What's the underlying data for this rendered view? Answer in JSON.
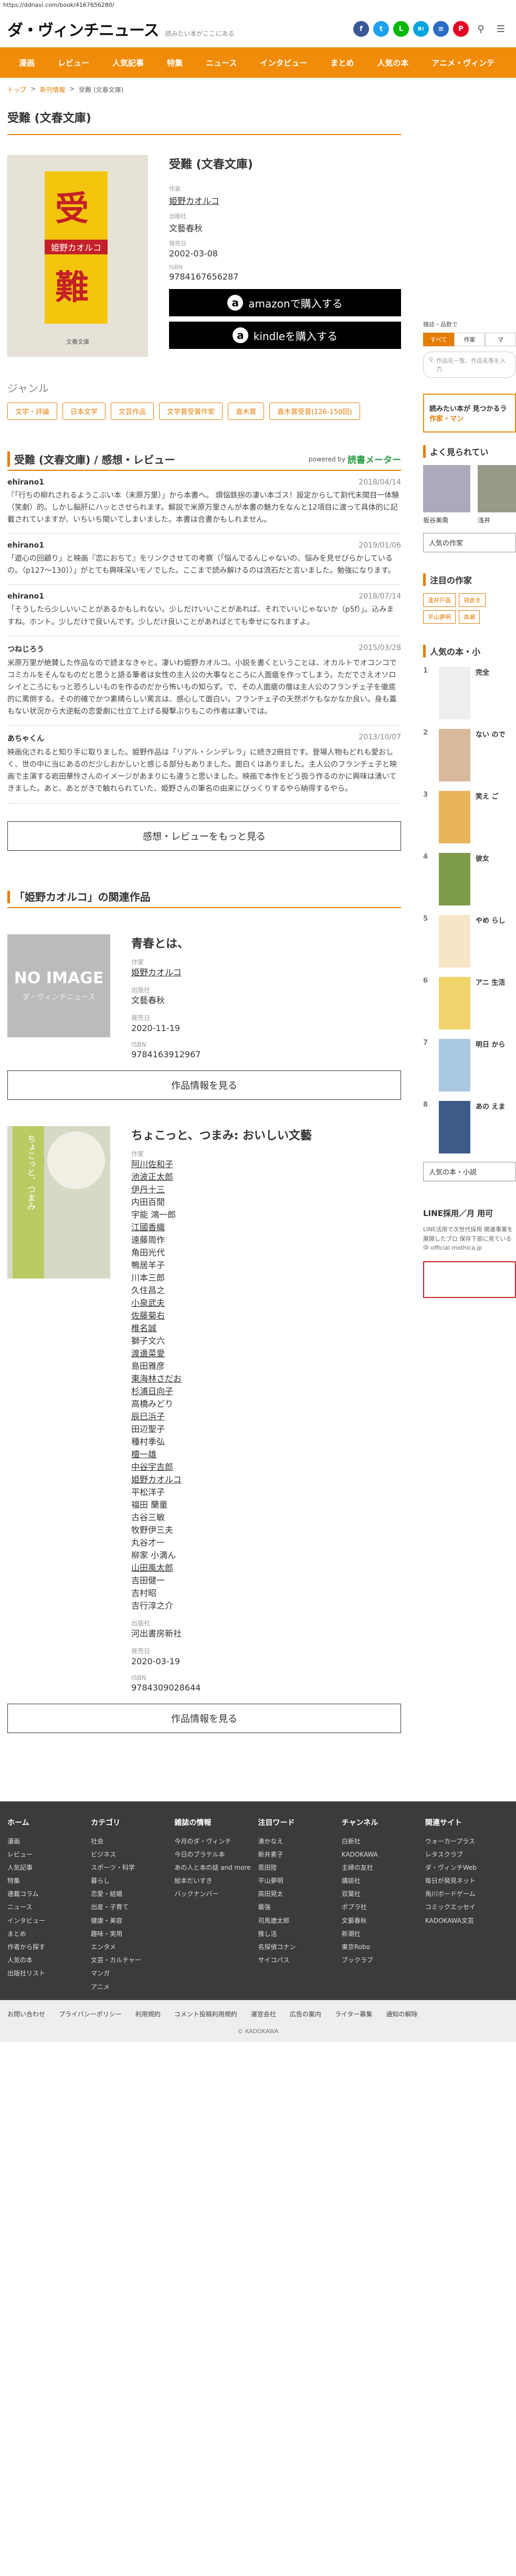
{
  "url": "https://ddnavi.com/book/4167656280/",
  "header": {
    "logo": "ダ・ヴィンチニュース",
    "tagline": "読みたい本がここにある"
  },
  "social": [
    {
      "name": "facebook-icon",
      "glyph": "f",
      "color": "#3b5998"
    },
    {
      "name": "twitter-icon",
      "glyph": "t",
      "color": "#1da1f2"
    },
    {
      "name": "line-icon",
      "glyph": "L",
      "color": "#00b900"
    },
    {
      "name": "hatena-icon",
      "glyph": "B!",
      "color": "#00a4de"
    },
    {
      "name": "feed-icon",
      "glyph": "≡",
      "color": "#2b6cc4"
    },
    {
      "name": "pinterest-icon",
      "glyph": "P",
      "color": "#e60023"
    }
  ],
  "nav": [
    "漫画",
    "レビュー",
    "人気記事",
    "特集",
    "ニュース",
    "インタビュー",
    "まとめ",
    "人気の本",
    "アニメ・ヴィンテ"
  ],
  "breadcrumb": {
    "home": "トップ",
    "sep": ">",
    "books": "新刊情報",
    "current": "受難 (文春文庫)"
  },
  "book": {
    "page_title": "受難 (文春文庫)",
    "title": "受難 (文春文庫)",
    "cover_kanji_1": "受",
    "cover_kanji_2": "難",
    "cover_author": "姫野カオルコ",
    "cover_foot": "文春文庫",
    "author_label": "作家",
    "author": "姫野カオルコ",
    "publisher_label": "出版社",
    "publisher": "文藝春秋",
    "date_label": "発売日",
    "date": "2002-03-08",
    "isbn_label": "ISBN",
    "isbn": "9784167656287",
    "amazon_btn": "amazonで購入する",
    "kindle_btn": "kindleを購入する"
  },
  "genre": {
    "heading": "ジャンル",
    "tags": [
      "文学・評論",
      "日本文学",
      "文芸作品",
      "文学賞受賞作家",
      "直木賞",
      "直木賞受賞(126-150回)"
    ]
  },
  "reviews": {
    "heading": "受難 (文春文庫) / 感想・レビュー",
    "powered": "powered by",
    "brand": "読書メーター",
    "items": [
      {
        "user": "ehirano1",
        "date": "2018/04/14",
        "text": "『「行ちの柳れされるようこぶい本（末原万里）」から本書へ。 煩悩鉄拐の凄い本ゴス！設定からして割代未聞目一体験（笑劇）的。しかし脳肝にハッとさせられます。解説で米原万里さんが本書の魅力をなんと12項目に渡って具体的に記載されていますが、いちいち聞いてしまいました。本書は合書かもしれません。"
      },
      {
        "user": "ehirano1",
        "date": "2019/01/06",
        "text": "「遊心の回顧り」と映画『恋におちて』をリンクさせての考察（「悩んでるんじゃないの、悩みを見せびらかしているの。（p127〜130））」がとても興味深いモノでした。ここまで読み解けるのは流石だと言いました。勉強になります。"
      },
      {
        "user": "ehirano1",
        "date": "2018/07/14",
        "text": "「そうしたら少しいいことがあるかもしれない。少しだけいいことがあれば、それでいいじゃないか（p5f）」。込みますね。ホント。少しだけで良いんです。少しだけ良いことがあればとても幸せになれますよ。"
      },
      {
        "user": "つねじろう",
        "date": "2015/03/28",
        "text": "米原万里が絶賛した作品なので読まなきゃと。凄いわ姫野カオルコ。小説を書くということは、オカルトでオコンコでコミカルをそんなものだと思うと語る筆者は女性の主人公の大事なところに人面瘡を作ってしまう。ただでさえオソロシイところにもっと恐ろしいものを作るのだから怖いもの知らず。で、その人面瘡の僧は主人公のフランチェ子を徹底的に罵倒する。その的確でかつ素晴らしい罵言は、感心して面白い。フランチェ子の天然ボケもなかなか良い。身も蓋もない状況から大逆転の恋愛劇に仕立て上げる擬撃ぶりもこの作者は凄いでは。"
      },
      {
        "user": "あちゃくん",
        "date": "2013/10/07",
        "text": "映画化されると知り手に取りました。姫野作品は「リアル・シンデレラ」に続き2冊目です。登場人物もどれも愛おしく、世の中に当にあるのだ少しおかしいと感じる部分もありました。面白くはありました。主人公のフランチェ子と映画で主演する岩田華怜さんのイメージがあまりにも違うと思いました。映画で本作をどう扱う作るのかに興味は湧いてきました。あと、あとがきで触れられていた、姫野さんの筆名の由来にびっくりするやら納得するやら。"
      }
    ],
    "more_btn": "感想・レビューをもっと見る"
  },
  "related": {
    "heading": "「姫野カオルコ」の関連作品",
    "items": [
      {
        "title": "青春とは、",
        "no_image": "NO IMAGE",
        "no_image_logo": "ダ・ヴィンチニュース",
        "author_label": "作家",
        "authors": [
          "姫野カオルコ"
        ],
        "publisher_label": "出版社",
        "publisher": "文藝春秋",
        "date_label": "発売日",
        "date": "2020-11-19",
        "isbn_label": "ISBN",
        "isbn": "9784163912967",
        "btn": "作品情報を見る"
      },
      {
        "title": "ちょこっと、つまみ: おいしい文藝",
        "cover_text": "ちょこっと、つまみ",
        "author_label": "作家",
        "authors": [
          "阿川佐和子",
          "池波正太郎",
          "伊丹十三",
          "内田百閒",
          "宇能 鴻一郎",
          "江國香織",
          "遠藤周作",
          "角田光代",
          "鴨居羊子",
          "川本三郎",
          "久住昌之",
          "小泉武夫",
          "佐藤菊右",
          "椎名誠",
          "獅子文六",
          "渡邊菜愛",
          "島田雅彦",
          "東海林さだお",
          "杉浦日向子",
          "高橋みどり",
          "辰巳浜子",
          "田辺聖子",
          "種村季弘",
          "檀一雄",
          "中谷宇吉郎",
          "姫野カオルコ",
          "平松洋子",
          "福田 蘭童",
          "古谷三敏",
          "牧野伊三夫",
          "丸谷才一",
          "柳家 小満ん",
          "山田風太郎",
          "吉田健一",
          "吉村昭",
          "吉行淳之介"
        ],
        "publisher_label": "出版社",
        "publisher": "河出書房新社",
        "date_label": "発売日",
        "date": "2020-03-19",
        "isbn_label": "ISBN",
        "isbn": "9784309028644",
        "btn": "作品情報を見る"
      }
    ]
  },
  "sidebar": {
    "search_label": "雑誌・品数で",
    "tabs": [
      "すべて",
      "作家",
      "マ"
    ],
    "search_placeholder": "作品名一覧、作品名等を入力",
    "banner": "読みたい本が 見つかるラ",
    "banner_sub": "作家・マン",
    "popular_authors_heading": "よく見られてい",
    "authors": [
      "坂谷美南",
      "浅井"
    ],
    "authors_btn": "人気の作家",
    "notable_heading": "注目の作家",
    "notable_tags": [
      "逢井戸昌",
      "貸倉ま",
      "平山夢明",
      "高瀬"
    ],
    "ranking_heading": "人気の本・小",
    "ranking": [
      {
        "n": "1",
        "t": "完全"
      },
      {
        "n": "2",
        "t": "ない ので"
      },
      {
        "n": "3",
        "t": "笑え ご"
      },
      {
        "n": "4",
        "t": "彼女"
      },
      {
        "n": "5",
        "t": "やめ らし"
      },
      {
        "n": "6",
        "t": "アニ 生活"
      },
      {
        "n": "7",
        "t": "明日 から"
      },
      {
        "n": "8",
        "t": "あの えま"
      }
    ],
    "ranking_btn": "人気の本・小説",
    "line_title": "LINE採用／月 用可",
    "line_sub": "LINE活用で次世代採用 関連事業を展開したプロ 保存下部に見ている 中 official.mothica.jp"
  },
  "footer": {
    "cols": [
      {
        "h": "ホーム",
        "links": [
          "漫画",
          "レビュー",
          "人気記事",
          "特集",
          "連載コラム",
          "ニュース",
          "インタビュー",
          "まとめ",
          "作者から探す",
          "人気の本",
          "出版社リスト"
        ]
      },
      {
        "h": "カテゴリ",
        "links": [
          "社会",
          "ビジネス",
          "スポーツ・科学",
          "暮らし",
          "恋愛・結婚",
          "出産・子育て",
          "健康・美容",
          "趣味・実用",
          "エンタメ",
          "文芸・カルチャー",
          "マンガ",
          "アニメ"
        ]
      },
      {
        "h": "雑誌の情報",
        "links": [
          "今月のダ・ヴィンチ",
          "今日のプラテル本",
          "あの人と本の話 and more",
          "絵本だいすき",
          "バックナンバー"
        ]
      },
      {
        "h": "注目ワード",
        "links": [
          "湊かなえ",
          "新井素子",
          "恩田陸",
          "平山夢明",
          "高田晃太",
          "最強",
          "司馬遼太郎",
          "推し活",
          "名探偵コナン",
          "サイコパス"
        ]
      },
      {
        "h": "チャンネル",
        "links": [
          "白新社",
          "KADOKAWA",
          "主婦の友社",
          "講談社",
          "双葉社",
          "ポプラ社",
          "文藝春秋",
          "新潮社",
          "東京Robo",
          "ブックラブ"
        ]
      },
      {
        "h": "関連サイト",
        "links": [
          "ウォーカープラス",
          "レタスクラブ",
          "ダ・ヴィンチWeb",
          "毎日が発見ネット",
          "角川ボードゲーム",
          "コミックエッセイ",
          "KADOKAWA文芸"
        ]
      }
    ],
    "bottom_links": [
      "お問い合わせ",
      "プライバシーポリシー",
      "利用規約",
      "コメント投稿利用規約",
      "運営会社",
      "広告の案内",
      "ライター募集",
      "通知の解除"
    ],
    "copyright": "© KADOKAWA"
  }
}
